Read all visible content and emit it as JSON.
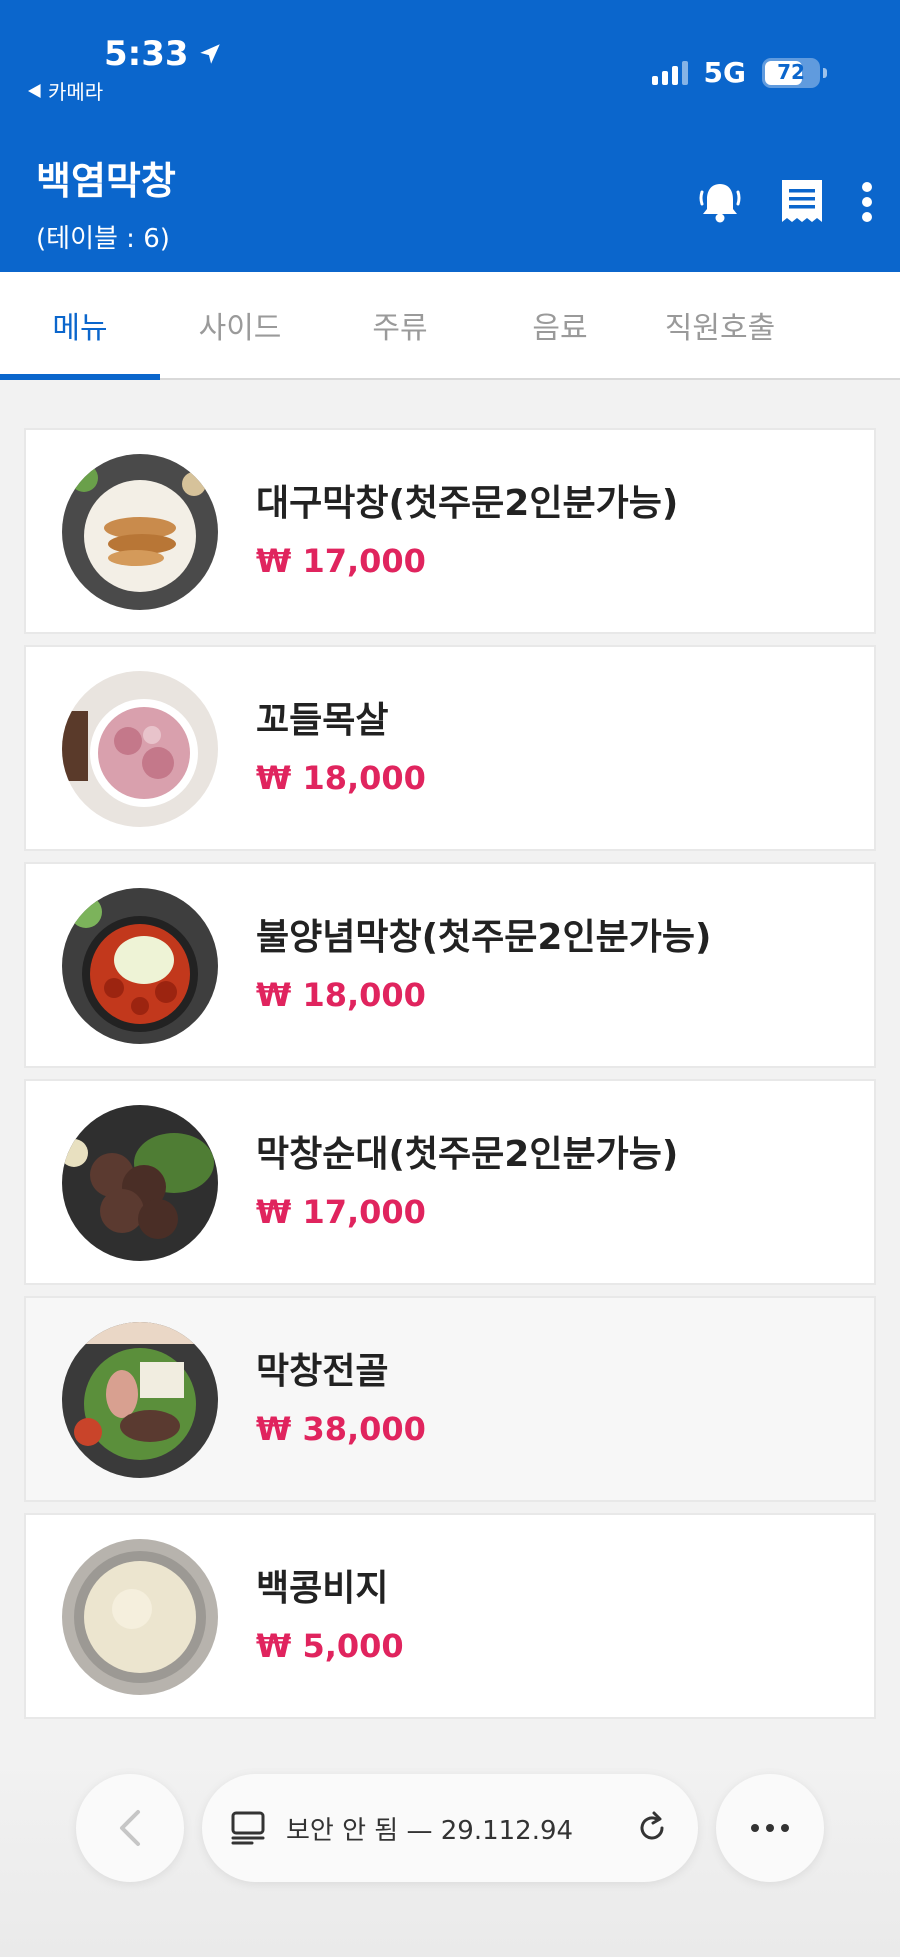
{
  "status_bar": {
    "time": "5:33",
    "back_app": "카메라",
    "network": "5G",
    "battery": "72",
    "battery_level": 0.72
  },
  "header": {
    "title": "백염막창",
    "table": "(테이블 : 6)",
    "icons": [
      "bell-icon",
      "receipt-icon",
      "more-vertical-icon"
    ],
    "colors": {
      "brand": "#0b66cc",
      "price": "#e0245e"
    }
  },
  "tabs": [
    {
      "label": "메뉴",
      "active": true
    },
    {
      "label": "사이드",
      "active": false
    },
    {
      "label": "주류",
      "active": false
    },
    {
      "label": "음료",
      "active": false
    },
    {
      "label": "직원호출",
      "active": false
    }
  ],
  "menu": [
    {
      "name": "대구막창(첫주문2인분가능)",
      "price": "₩ 17,000"
    },
    {
      "name": "꼬들목살",
      "price": "₩ 18,000"
    },
    {
      "name": "불양념막창(첫주문2인분가능)",
      "price": "₩ 18,000"
    },
    {
      "name": "막창순대(첫주문2인분가능)",
      "price": "₩ 17,000"
    },
    {
      "name": "막창전골",
      "price": "₩ 38,000"
    },
    {
      "name": "백콩비지",
      "price": "₩ 5,000"
    }
  ],
  "browser": {
    "url": "보안 안 됨 — 29.112.94"
  }
}
